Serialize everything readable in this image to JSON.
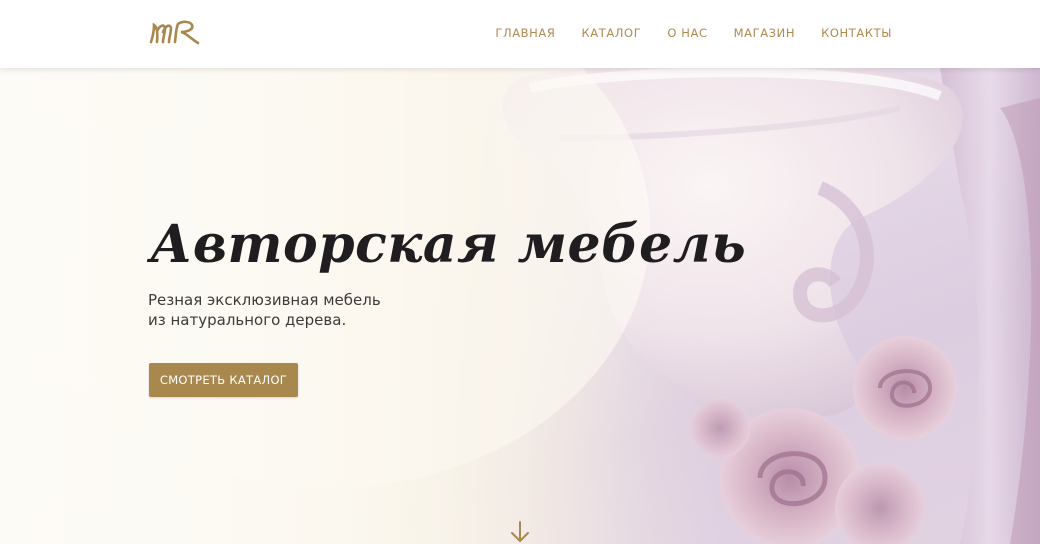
{
  "brand": {
    "logo_icon": "mr-monogram-logo",
    "accent_color": "#a9884e"
  },
  "nav": {
    "items": [
      {
        "label": "ГЛАВНАЯ"
      },
      {
        "label": "КАТАЛОГ"
      },
      {
        "label": "О НАС"
      },
      {
        "label": "МАГАЗИН"
      },
      {
        "label": "КОНТАКТЫ"
      }
    ]
  },
  "hero": {
    "title": "Авторская мебель",
    "subtitle_line1": "Резная эксклюзивная мебель",
    "subtitle_line2": "из натурального дерева.",
    "cta_label": "СМОТРЕТЬ КАТАЛОГ",
    "scroll_icon": "arrow-down-icon"
  }
}
